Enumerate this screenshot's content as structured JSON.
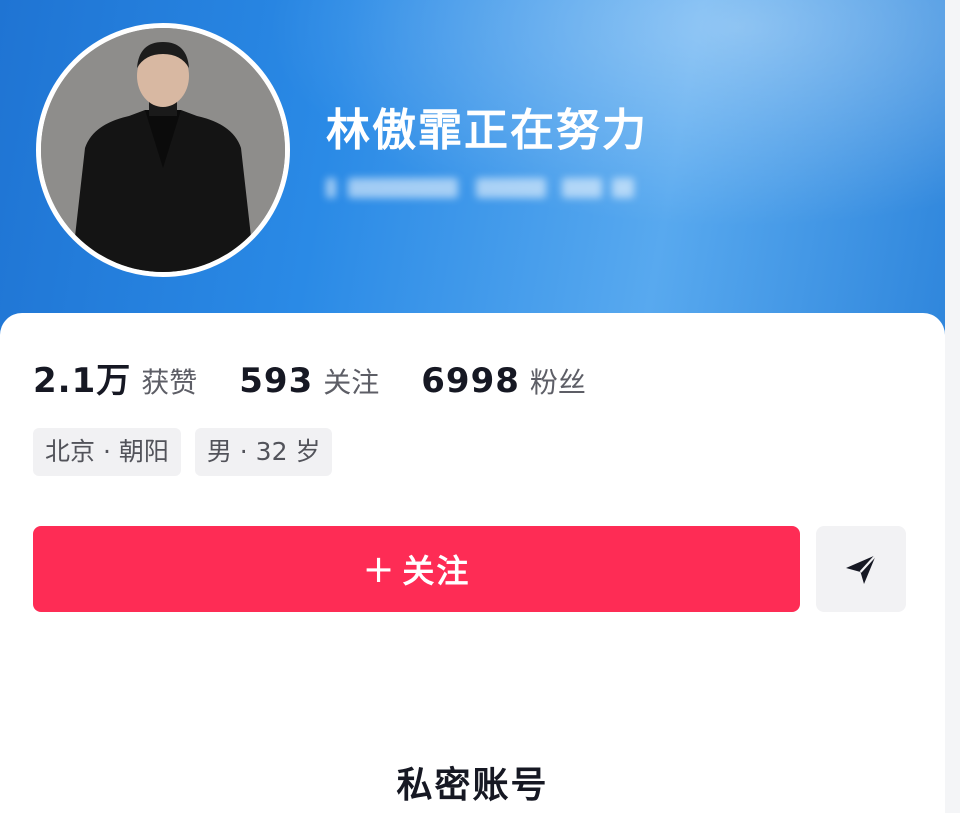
{
  "profile": {
    "username": "林傲霏正在努力"
  },
  "stats": [
    {
      "value": "2.1万",
      "label": "获赞"
    },
    {
      "value": "593",
      "label": "关注"
    },
    {
      "value": "6998",
      "label": "粉丝"
    }
  ],
  "tags": [
    "北京 · 朝阳",
    "男 · 32 岁"
  ],
  "actions": {
    "follow_plus": "+",
    "follow_label": "关注",
    "share_icon": "send-icon"
  },
  "content": {
    "private_label": "私密账号"
  },
  "colors": {
    "header_blue": "#2a8ae6",
    "follow_red": "#fe2c55"
  }
}
